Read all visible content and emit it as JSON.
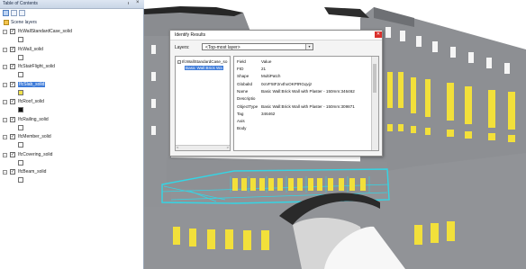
{
  "toc": {
    "title": "Table of Contents",
    "pin_glyph": "ᵻ",
    "close_glyph": "×",
    "tools": [
      "list-by-drawing-order-icon",
      "list-by-source-icon",
      "list-by-visibility-icon"
    ],
    "root_label": "Scene layers",
    "layers": [
      {
        "name": "IfcWallStandardCase_solid",
        "checked": true,
        "selected": false,
        "swatch": "#ffffff"
      },
      {
        "name": "IfcWall_solid",
        "checked": true,
        "selected": false,
        "swatch": "#ffffff"
      },
      {
        "name": "IfcStairFlight_solid",
        "checked": true,
        "selected": false,
        "swatch": "#ffffff"
      },
      {
        "name": "IfcSlab_solid",
        "checked": true,
        "selected": true,
        "swatch": "#f0e14a"
      },
      {
        "name": "IfcRoof_solid",
        "checked": true,
        "selected": false,
        "swatch": "#111111"
      },
      {
        "name": "IfcRailing_solid",
        "checked": true,
        "selected": false,
        "swatch": "#ffffff"
      },
      {
        "name": "IfcMember_solid",
        "checked": true,
        "selected": false,
        "swatch": "#ffffff"
      },
      {
        "name": "IfcCovering_solid",
        "checked": true,
        "selected": false,
        "swatch": "#ffffff"
      },
      {
        "name": "IfcBeam_solid",
        "checked": true,
        "selected": false,
        "swatch": "#ffffff"
      }
    ],
    "check_glyph": "✓",
    "expand_glyph": "−"
  },
  "identify": {
    "title": "Identify Results",
    "close_glyph": "✕",
    "layers_label": "Layers:",
    "layers_value": "<Top-most layer>",
    "dropdown_glyph": "▾",
    "tree_parent": "IfcWallStandardCase_so",
    "tree_child": "Basic Wall:Brick Wa",
    "tree_expand": "−",
    "scroll_left": "<",
    "scroll_right": ">",
    "header": {
      "field": "Field",
      "value": "Value"
    },
    "rows": [
      {
        "field": "FID",
        "value": "21"
      },
      {
        "field": "Shape",
        "value": "MultiPatch"
      },
      {
        "field": "GlobalId",
        "value": "0oVF5tF2n4hxOKPtRGqvjz"
      },
      {
        "field": "Name",
        "value": "Basic Wall:Brick Wall with Plaster - 150mm:346462"
      },
      {
        "field": "Descriptio",
        "value": ""
      },
      {
        "field": "ObjectType",
        "value": "Basic Wall:Brick Wall with Plaster - 150mm:309871"
      },
      {
        "field": "Tag",
        "value": "346462"
      },
      {
        "field": "Axis",
        "value": ""
      },
      {
        "field": "Body",
        "value": ""
      }
    ]
  },
  "colors": {
    "wall_grey": "#8a8c90",
    "window_yellow": "#f2e03a",
    "selection_cyan": "#33d6e6",
    "roof_dark": "#2b2b2b",
    "selection_blue": "#3d7bd9"
  }
}
